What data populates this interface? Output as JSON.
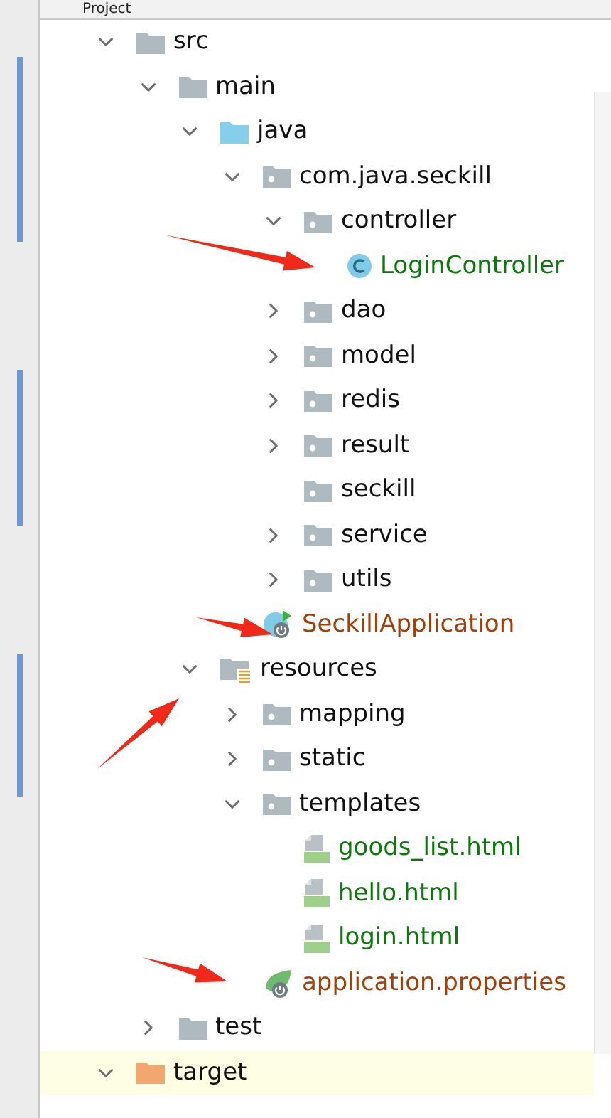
{
  "panel": {
    "title": "Project"
  },
  "tree": [
    {
      "label": "src",
      "kind": "folder",
      "expanded": true,
      "highlighted": false,
      "color": "#111111",
      "children": [
        {
          "label": "main",
          "kind": "folder",
          "expanded": true,
          "highlighted": false,
          "color": "#111111",
          "children": [
            {
              "label": "java",
              "kind": "source-folder",
              "expanded": true,
              "highlighted": false,
              "color": "#111111",
              "children": [
                {
                  "label": "com.java.seckill",
                  "kind": "package",
                  "expanded": true,
                  "highlighted": false,
                  "color": "#111111",
                  "children": [
                    {
                      "label": "controller",
                      "kind": "package",
                      "expanded": true,
                      "highlighted": false,
                      "color": "#111111",
                      "children": [
                        {
                          "label": "LoginController",
                          "kind": "class",
                          "highlighted": false,
                          "color": "#0a7a0a"
                        }
                      ]
                    },
                    {
                      "label": "dao",
                      "kind": "package",
                      "expanded": false,
                      "highlighted": false,
                      "color": "#111111"
                    },
                    {
                      "label": "model",
                      "kind": "package",
                      "expanded": false,
                      "highlighted": false,
                      "color": "#111111"
                    },
                    {
                      "label": "redis",
                      "kind": "package",
                      "expanded": false,
                      "highlighted": false,
                      "color": "#111111"
                    },
                    {
                      "label": "result",
                      "kind": "package",
                      "expanded": false,
                      "highlighted": false,
                      "color": "#111111"
                    },
                    {
                      "label": "seckill",
                      "kind": "package",
                      "highlighted": false,
                      "color": "#111111"
                    },
                    {
                      "label": "service",
                      "kind": "package",
                      "expanded": false,
                      "highlighted": false,
                      "color": "#111111"
                    },
                    {
                      "label": "utils",
                      "kind": "package",
                      "expanded": false,
                      "highlighted": false,
                      "color": "#111111"
                    }
                  ]
                },
                {
                  "label": "SeckillApplication",
                  "kind": "spring-class",
                  "highlighted": false,
                  "color": "#a0400a"
                }
              ]
            },
            {
              "label": "resources",
              "kind": "resources-folder",
              "expanded": true,
              "highlighted": false,
              "color": "#111111",
              "children": [
                {
                  "label": "mapping",
                  "kind": "package",
                  "expanded": false,
                  "highlighted": false,
                  "color": "#111111"
                },
                {
                  "label": "static",
                  "kind": "package",
                  "expanded": false,
                  "highlighted": false,
                  "color": "#111111"
                },
                {
                  "label": "templates",
                  "kind": "package",
                  "expanded": true,
                  "highlighted": false,
                  "color": "#111111",
                  "children": [
                    {
                      "label": "goods_list.html",
                      "kind": "html",
                      "highlighted": false,
                      "color": "#0a7a0a"
                    },
                    {
                      "label": "hello.html",
                      "kind": "html",
                      "highlighted": false,
                      "color": "#0a7a0a"
                    },
                    {
                      "label": "login.html",
                      "kind": "html",
                      "highlighted": false,
                      "color": "#0a7a0a"
                    }
                  ]
                },
                {
                  "label": "application.properties",
                  "kind": "spring-properties",
                  "highlighted": false,
                  "color": "#a0400a"
                }
              ]
            }
          ]
        },
        {
          "label": "test",
          "kind": "folder",
          "expanded": false,
          "highlighted": false,
          "color": "#111111"
        }
      ]
    },
    {
      "label": "target",
      "kind": "excluded-folder",
      "expanded": true,
      "highlighted": true,
      "color": "#111111"
    }
  ]
}
